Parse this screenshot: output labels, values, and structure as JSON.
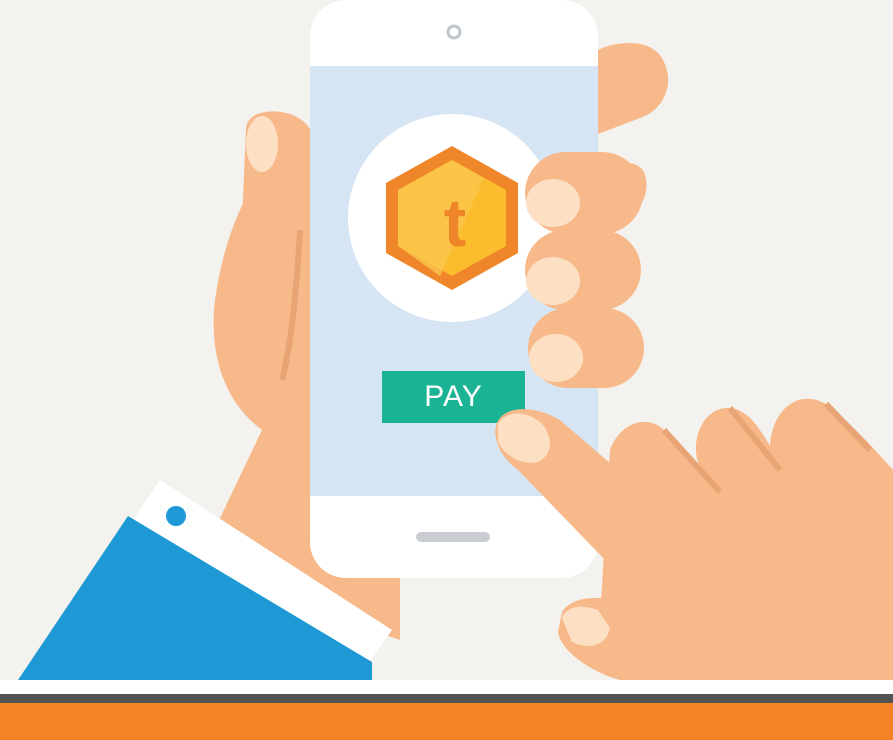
{
  "pay_button": {
    "label": "PAY"
  },
  "coin": {
    "letter": "t"
  },
  "colors": {
    "background": "#f3f2ef",
    "screen": "#d6e5f3",
    "phone": "#ffffff",
    "accent": "#1ab394",
    "coin_outer": "#f0862a",
    "coin_inner": "#fbbd2e",
    "skin": "#f8b98a",
    "nail": "#fde0c4",
    "sleeve": "#1f99d6",
    "cuff": "#ffffff",
    "stripe_dark": "#525252",
    "stripe_orange": "#f48323"
  }
}
